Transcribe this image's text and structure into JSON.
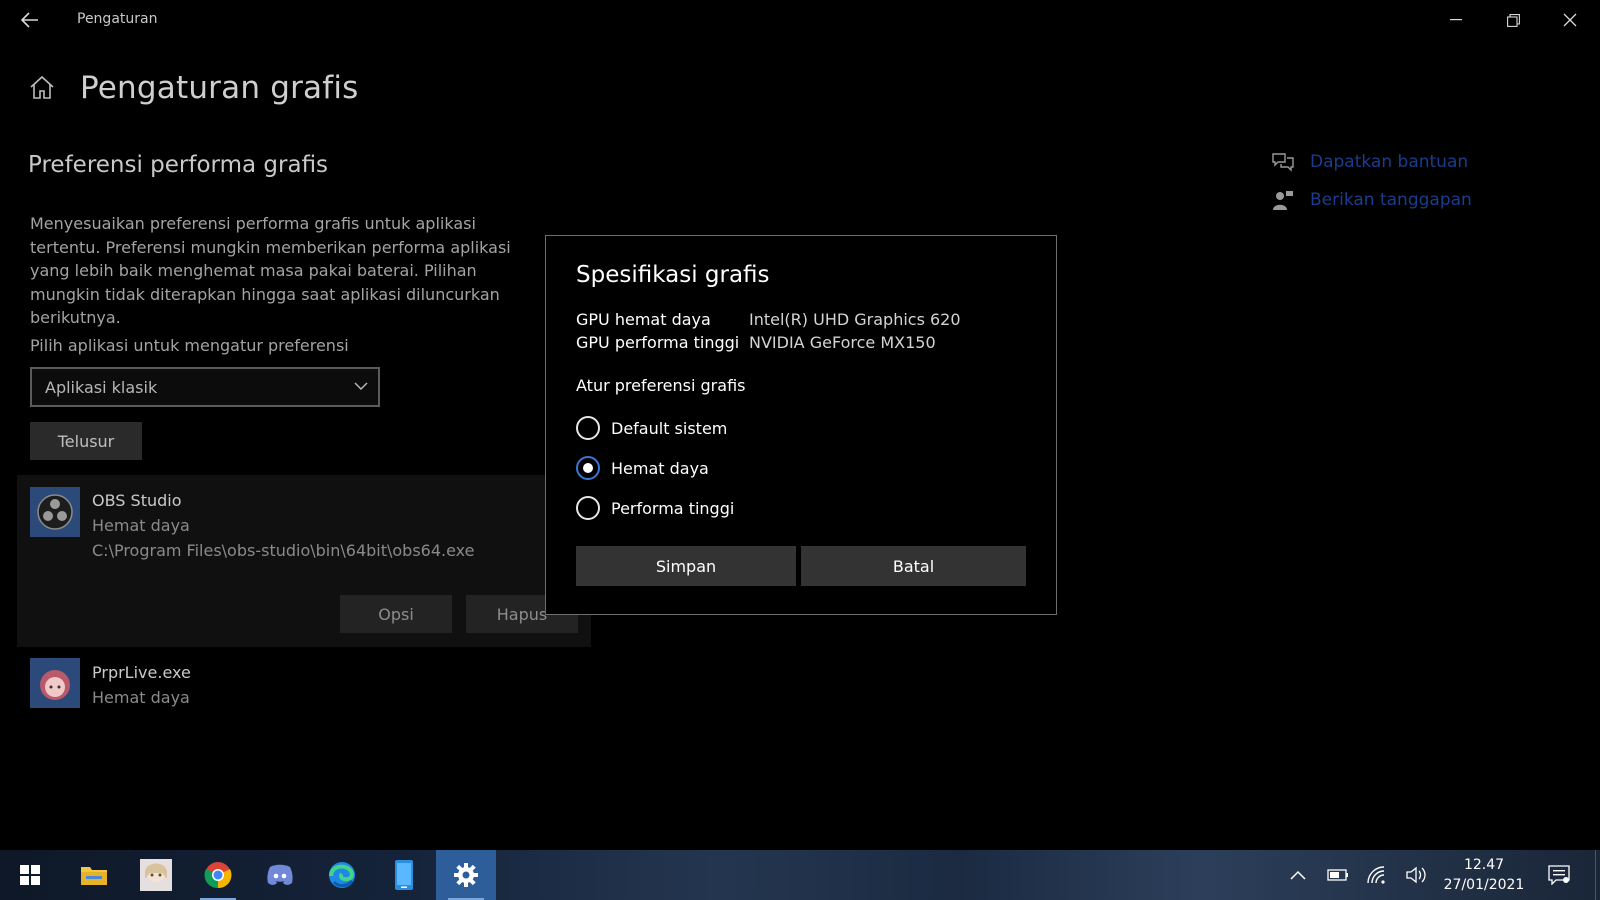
{
  "window": {
    "title": "Pengaturan"
  },
  "header": {
    "title": "Pengaturan grafis"
  },
  "section": {
    "title": "Preferensi performa grafis",
    "description": "Menyesuaikan preferensi performa grafis untuk aplikasi tertentu. Preferensi mungkin memberikan performa aplikasi yang lebih baik menghemat masa pakai baterai. Pilihan mungkin tidak diterapkan hingga saat aplikasi diluncurkan berikutnya."
  },
  "picker": {
    "label": "Pilih aplikasi untuk mengatur preferensi",
    "selected": "Aplikasi klasik",
    "browse_label": "Telusur"
  },
  "apps": [
    {
      "name": "OBS Studio",
      "preference": "Hemat daya",
      "path": "C:\\Program Files\\obs-studio\\bin\\64bit\\obs64.exe",
      "options_label": "Opsi",
      "remove_label": "Hapus"
    },
    {
      "name": "PrprLive.exe",
      "preference": "Hemat daya"
    }
  ],
  "help": {
    "get_help": "Dapatkan bantuan",
    "give_feedback": "Berikan tanggapan"
  },
  "dialog": {
    "title": "Spesifikasi grafis",
    "specs": [
      {
        "label": "GPU hemat daya",
        "value": "Intel(R) UHD Graphics 620"
      },
      {
        "label": "GPU performa tinggi",
        "value": "NVIDIA GeForce MX150"
      }
    ],
    "pref_label": "Atur preferensi grafis",
    "options": [
      {
        "label": "Default sistem",
        "checked": false
      },
      {
        "label": "Hemat daya",
        "checked": true
      },
      {
        "label": "Performa tinggi",
        "checked": false
      }
    ],
    "save_label": "Simpan",
    "cancel_label": "Batal"
  },
  "taskbar": {
    "apps": [
      "start-icon",
      "file-explorer-icon",
      "anime-app-icon",
      "chrome-icon",
      "discord-icon",
      "edge-icon",
      "phone-app-icon",
      "settings-icon"
    ],
    "active": "settings-icon",
    "tray": [
      "chevron-up-icon",
      "battery-icon",
      "wifi-icon",
      "volume-icon",
      "notification-icon"
    ],
    "time": "12.47",
    "date": "27/01/2021"
  },
  "colors": {
    "accent": "#3a76d4",
    "link": "#1a3d8f",
    "taskbar_active": "#2e5e99"
  }
}
